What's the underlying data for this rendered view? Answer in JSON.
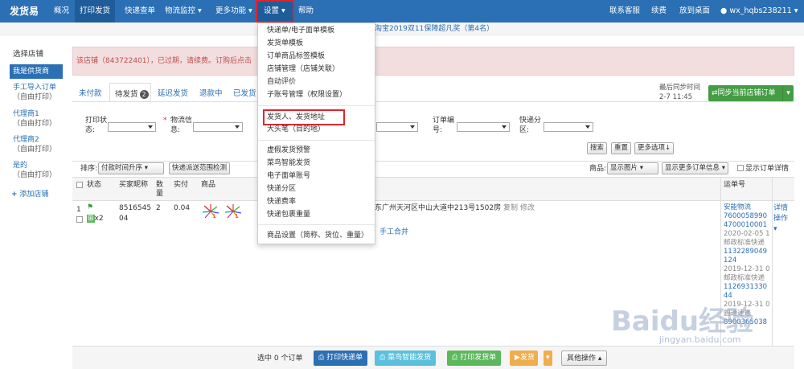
{
  "nav": {
    "brand": "发货易",
    "items": [
      "概况",
      "打印发货",
      "快递查单",
      "物流监控",
      "更多功能",
      "设置",
      "帮助"
    ],
    "right": [
      "联系客服",
      "续费",
      "放到桌面",
      "wx_hqbs238211"
    ]
  },
  "notice": "淘宝2019双11保障超凡奖（第4名）",
  "sidebar": {
    "title": "选择店铺",
    "active": "我是供货商",
    "items": [
      {
        "label": "手工导入订单",
        "sub": "（自由打印）"
      },
      {
        "label": "代理商1",
        "sub": "（自由打印）"
      },
      {
        "label": "代理商2",
        "sub": "（自由打印）"
      },
      {
        "label": "是的",
        "sub": "（自由打印）"
      }
    ],
    "add": "添加店铺"
  },
  "alert": "该店铺（843722401），已过期，请续费。订购后点击",
  "tabs": [
    "未付款",
    "待发货",
    "延迟发货",
    "退款中",
    "已发货"
  ],
  "tab_badge": "2",
  "sync": {
    "label": "最后同步时间",
    "time": "2-7 11:45",
    "button": "同步当前店铺订单"
  },
  "filters": {
    "print_status": "打印状态:",
    "logistics": "物流信息:",
    "order_no": "订单编号:",
    "express_zone": "快递分区:",
    "search": "搜索",
    "reset": "重置",
    "more": "更多选项↓"
  },
  "sort": {
    "label": "排序:",
    "value": "付款时间升序",
    "check_btn": "快递派送范围检测"
  },
  "goods": {
    "label": "商品:",
    "show_pic": "显示图片",
    "show_more": "显示更多订单信息",
    "show_detail": "显示订单详情"
  },
  "table_headers": [
    "状态",
    "买家昵称",
    "数量",
    "实付",
    "商品",
    "运单号"
  ],
  "row": {
    "index": "1",
    "qty_badge": "x2",
    "buyer": "8516545 04",
    "count": "2",
    "paid": "0.04",
    "address": "东广州天河区中山大道中213号1502房",
    "copy": "复制",
    "edit": "修改",
    "merge": "手工合并",
    "detail": "详情",
    "op": "操作"
  },
  "waybills": [
    "安能物流",
    "7600058990",
    "4700010001",
    "2020-02-05 1",
    "邮政标准快递",
    "1132289049",
    "124",
    "2019-12-31 0",
    "邮政标准快递",
    "1126931330",
    "44",
    "2019-12-31 0",
    "圆通速递",
    "8900365038"
  ],
  "footer": {
    "selected": "选中 0 个订单",
    "print_express": "打印快递单",
    "cainiao": "菜鸟智能发货",
    "print_ship": "打印发货单",
    "ship": "发货",
    "other": "其他操作"
  },
  "menu": {
    "group1": [
      "快递单/电子面单模板",
      "发货单模板",
      "订单商品标签模板",
      "店铺管理（店铺关联）",
      "自动评价",
      "子账号管理（权限设置）"
    ],
    "group2": [
      "发货人、发货地址",
      "大头笔（目的地）"
    ],
    "group3": [
      "虚假发货预警",
      "菜鸟智能发货",
      "电子面单账号",
      "快递分区",
      "快递费率",
      "快递包裹重量"
    ],
    "group4": [
      "商品设置（简称、货位、重量）"
    ]
  },
  "watermark": "Baidu经验",
  "watermark_sub": "jingyan.baidu.com"
}
